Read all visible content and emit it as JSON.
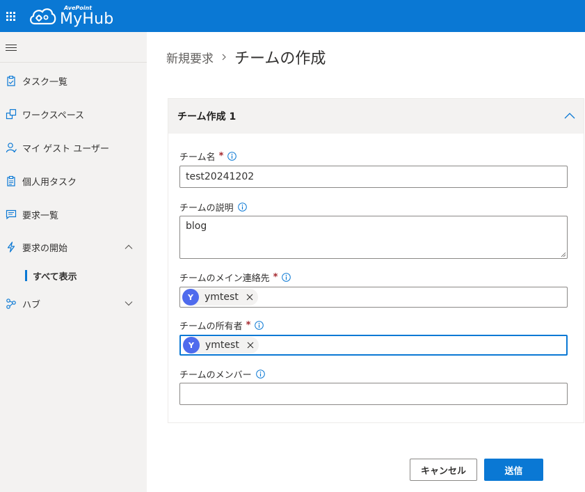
{
  "app": {
    "vendor": "AvePoint",
    "product": "MyHub",
    "brand_color": "#0a78d4"
  },
  "sidebar": {
    "items": [
      {
        "label": "タスク一覧",
        "icon": "clipboard-icon"
      },
      {
        "label": "ワークスペース",
        "icon": "workspace-icon"
      },
      {
        "label": "マイ ゲスト ユーザー",
        "icon": "guest-user-icon"
      },
      {
        "label": "個人用タスク",
        "icon": "personal-task-icon"
      },
      {
        "label": "要求一覧",
        "icon": "request-list-icon"
      },
      {
        "label": "要求の開始",
        "icon": "lightning-icon",
        "expanded": true
      },
      {
        "label": "ハブ",
        "icon": "hub-icon",
        "expanded": false
      }
    ],
    "sub_items": [
      {
        "label": "すべて表示",
        "selected": true
      }
    ]
  },
  "breadcrumb": {
    "parent": "新規要求",
    "current": "チームの作成"
  },
  "form": {
    "section_title": "チーム作成 1",
    "fields": {
      "team_name": {
        "label": "チーム名",
        "required": true,
        "value": "test20241202"
      },
      "description": {
        "label": "チームの説明",
        "required": false,
        "value": "blog"
      },
      "primary_contact": {
        "label": "チームのメイン連絡先",
        "required": true,
        "people": [
          {
            "initial": "Y",
            "name": "ymtest"
          }
        ]
      },
      "owner": {
        "label": "チームの所有者",
        "required": true,
        "people": [
          {
            "initial": "Y",
            "name": "ymtest"
          }
        ]
      },
      "members": {
        "label": "チームのメンバー",
        "required": false,
        "value": ""
      }
    },
    "required_marker": "*"
  },
  "actions": {
    "cancel_label": "キャンセル",
    "submit_label": "送信"
  }
}
